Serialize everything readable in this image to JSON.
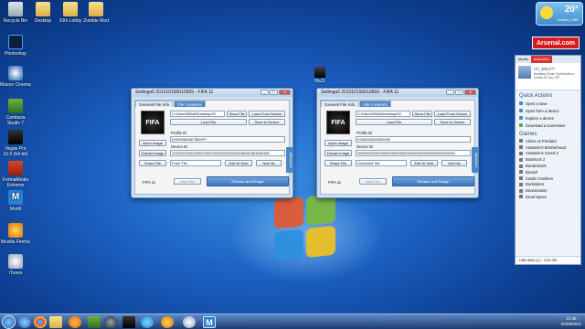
{
  "desktop": {
    "icons": [
      {
        "label": "Recycle Bin"
      },
      {
        "label": "Desktop"
      },
      {
        "label": "10th Lobby"
      },
      {
        "label": "Zombie Mod"
      },
      {
        "label": "Photoshop"
      },
      {
        "label": "Maxon Cinema"
      },
      {
        "label": "Camtasia Studio 7"
      },
      {
        "label": "Vegas Pro 10.0 (64-bit)"
      },
      {
        "label": "FormaMedia Extreme"
      },
      {
        "label": "ModIt"
      },
      {
        "label": "Mozilla Firefox"
      },
      {
        "label": "iTunes"
      }
    ],
    "fifa_file_label": "fifa11"
  },
  "weather": {
    "temp": "20°",
    "city": "Dudley, GBR"
  },
  "arsenal": {
    "label": "Arsenal.com"
  },
  "windows": [
    {
      "title": "Settings0 201010150010659 - FIFA 11",
      "tabs": [
        "General File Info",
        "File Contents"
      ],
      "path": "C:\\Users\\Elliott\\Desktop\\Gf",
      "btn_show_file": "Show File",
      "btn_load_device": "Load From Device",
      "btn_load_file": "Load File",
      "btn_save_device": "Save to Device",
      "profile_id_label": "Profile ID",
      "profile_id": "E0000963AE7BD9F7",
      "device_id_label": "Device ID",
      "device_id": "202020202020202020202020202020204536345463482484",
      "btn_inject": "Inject Image",
      "btn_extract": "Extract Image",
      "btn_share": "Share File",
      "logo": "FIFA 11",
      "select_value": "From File",
      "btn_edit_id": "Edit ID Setc",
      "btn_null": "Null Ids",
      "game_label": "FIFA 11",
      "btn_mod_file": "Mod File",
      "btn_rehash": "Rehash and Resign",
      "side_label": "Advanced"
    },
    {
      "title": "Settings0 201010150010659 - FIFA 11",
      "tabs": [
        "General File Info",
        "File Contents"
      ],
      "path": "C:\\Users\\Elliott\\Desktop\\Gf",
      "btn_show_file": "Show File",
      "btn_load_device": "Load From Device",
      "btn_load_file": "Load File",
      "btn_save_device": "Save to Device",
      "profile_id_label": "Profile ID",
      "profile_id": "E000000000000000",
      "device_id_label": "Device ID",
      "device_id": "000000000000000000000000000000000000000000000000",
      "btn_inject": "Inject Image",
      "btn_extract": "Extract Image",
      "btn_share": "Share File",
      "logo": "FIFA 11",
      "select_value": "Unnamed Set",
      "btn_edit_id": "Edit ID Setc",
      "btn_null": "Null Ids",
      "game_label": "FIFA 11",
      "btn_mod_file": "Mod File",
      "btn_rehash": "Rehash and Resign",
      "side_label": "Advanced"
    }
  ],
  "launcher": {
    "tabs": [
      "Modio",
      "Activation"
    ],
    "profile_name": "iTz_EllioTT",
    "profile_status": "Awaiting Email Confirmation - Invited to Dev VIP",
    "quick_actions_title": "Quick Actions",
    "quick_actions": [
      "Open a save",
      "Open from a device",
      "Explore a device",
      "Download a Gamesave"
    ],
    "games_title": "Games",
    "games": [
      "Aliens vs Predator",
      "Assassin's Brotherhood",
      "Assassin's Creed 2",
      "BioShock 2",
      "Borderlands",
      "Breach",
      "Castle Crashers",
      "Darksiders",
      "Deamination",
      "Dead Space"
    ],
    "footer": "USB Stick (J:) - 3.32 GB"
  },
  "taskbar": {
    "time": "21:36",
    "date": "02/06/2011"
  }
}
